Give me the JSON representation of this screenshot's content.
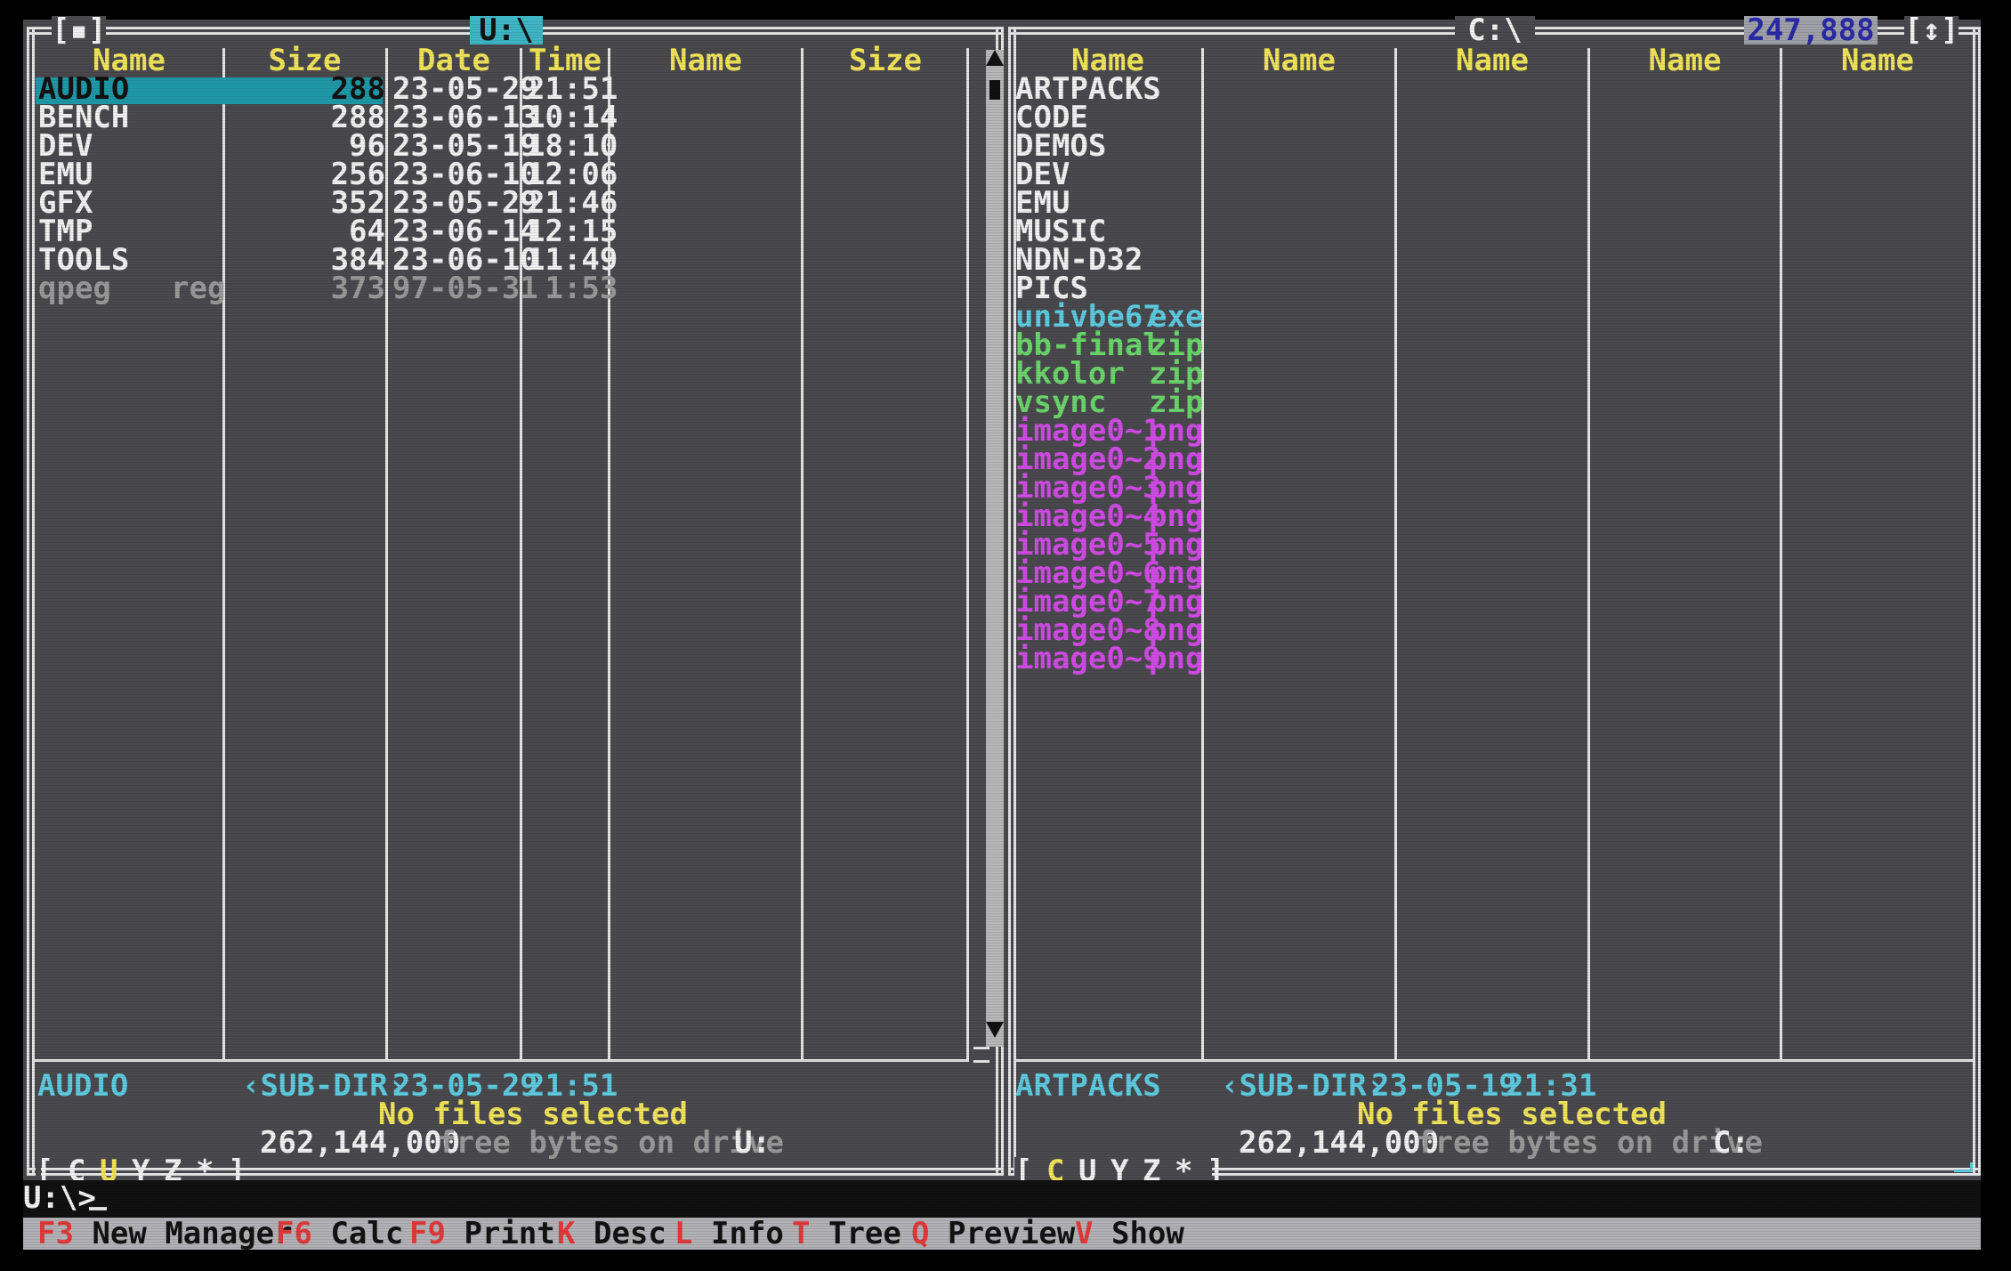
{
  "colors": {
    "background": "#4a4a4e",
    "frame": "#e6e6e6",
    "header": "#f2e45a",
    "cursor": "#1f99a8",
    "dirs": "#f2f2f2",
    "exe": "#5ecbe0",
    "zip": "#6bd66b",
    "png": "#d24be6",
    "key": "#e03a3a"
  },
  "left": {
    "title": "U:\\",
    "corner_left": "[▪]",
    "headers": {
      "name": "Name",
      "size": "Size",
      "date": "Date",
      "time": "Time",
      "name2": "Name",
      "size2": "Size"
    },
    "rows": [
      {
        "name": "AUDIO",
        "size": "288",
        "date": "23-05-29",
        "time": "21:51"
      },
      {
        "name": "BENCH",
        "size": "288",
        "date": "23-06-13",
        "time": "10:14"
      },
      {
        "name": "DEV",
        "size": "96",
        "date": "23-05-19",
        "time": "18:10"
      },
      {
        "name": "EMU",
        "size": "256",
        "date": "23-06-10",
        "time": "12:06"
      },
      {
        "name": "GFX",
        "size": "352",
        "date": "23-05-29",
        "time": "21:46"
      },
      {
        "name": "TMP",
        "size": "64",
        "date": "23-06-14",
        "time": "12:15"
      },
      {
        "name": "TOOLS",
        "size": "384",
        "date": "23-06-10",
        "time": "11:49"
      },
      {
        "name": "qpeg",
        "ext": "reg",
        "size": "373",
        "date": "97-05-31",
        "time": " 1:53"
      }
    ],
    "info_name": "AUDIO",
    "info_type": "‹SUB-DIR›",
    "info_date": "23-05-29",
    "info_time": "21:51",
    "selected": "No files selected",
    "free_bytes": "262,144,000",
    "free_text": "free bytes on drive",
    "drive": "U:",
    "drives_prefix": "[",
    "drives": [
      "C",
      "U",
      "Y",
      "Z",
      "*"
    ],
    "drives_suffix": "]"
  },
  "right": {
    "title": "C:\\",
    "size_info": "247,888",
    "corner_right": "[↕]",
    "headers": [
      "Name",
      "Name",
      "Name",
      "Name",
      "Name"
    ],
    "rows": [
      {
        "name": "ARTPACKS",
        "ext": "",
        "kind": "dir"
      },
      {
        "name": "CODE",
        "ext": "",
        "kind": "dir"
      },
      {
        "name": "DEMOS",
        "ext": "",
        "kind": "dir"
      },
      {
        "name": "DEV",
        "ext": "",
        "kind": "dir"
      },
      {
        "name": "EMU",
        "ext": "",
        "kind": "dir"
      },
      {
        "name": "MUSIC",
        "ext": "",
        "kind": "dir"
      },
      {
        "name": "NDN-D32",
        "ext": "",
        "kind": "dir"
      },
      {
        "name": "PICS",
        "ext": "",
        "kind": "dir"
      },
      {
        "name": "univbe67",
        "ext": "exe",
        "kind": "exe"
      },
      {
        "name": "bb-final",
        "ext": "zip",
        "kind": "zip"
      },
      {
        "name": "kkolor",
        "ext": "zip",
        "kind": "zip"
      },
      {
        "name": "vsync",
        "ext": "zip",
        "kind": "zip"
      },
      {
        "name": "image0~1",
        "ext": "png",
        "kind": "png"
      },
      {
        "name": "image0~2",
        "ext": "png",
        "kind": "png"
      },
      {
        "name": "image0~3",
        "ext": "png",
        "kind": "png"
      },
      {
        "name": "image0~4",
        "ext": "png",
        "kind": "png"
      },
      {
        "name": "image0~5",
        "ext": "png",
        "kind": "png"
      },
      {
        "name": "image0~6",
        "ext": "png",
        "kind": "png"
      },
      {
        "name": "image0~7",
        "ext": "png",
        "kind": "png"
      },
      {
        "name": "image0~8",
        "ext": "png",
        "kind": "png"
      },
      {
        "name": "image0~9",
        "ext": "png",
        "kind": "png"
      }
    ],
    "info_name": "ARTPACKS",
    "info_type": "‹SUB-DIR›",
    "info_date": "23-05-19",
    "info_time": "21:31",
    "selected": "No files selected",
    "free_bytes": "262,144,000",
    "free_text": "free bytes on drive",
    "drive": "C:",
    "drives_prefix": "[",
    "drives": [
      "C",
      "U",
      "Y",
      "Z",
      "*"
    ],
    "drives_suffix": "]"
  },
  "prompt": "U:\\>",
  "keybar": [
    {
      "key": "F3",
      "label": "New Manager"
    },
    {
      "key": "F6",
      "label": "Calc"
    },
    {
      "key": "F9",
      "label": "Print"
    },
    {
      "key": "K",
      "label": "Desc"
    },
    {
      "key": "L",
      "label": "Info"
    },
    {
      "key": "T",
      "label": "Tree"
    },
    {
      "key": "Q",
      "label": "Preview"
    },
    {
      "key": "V",
      "label": "Show"
    }
  ]
}
